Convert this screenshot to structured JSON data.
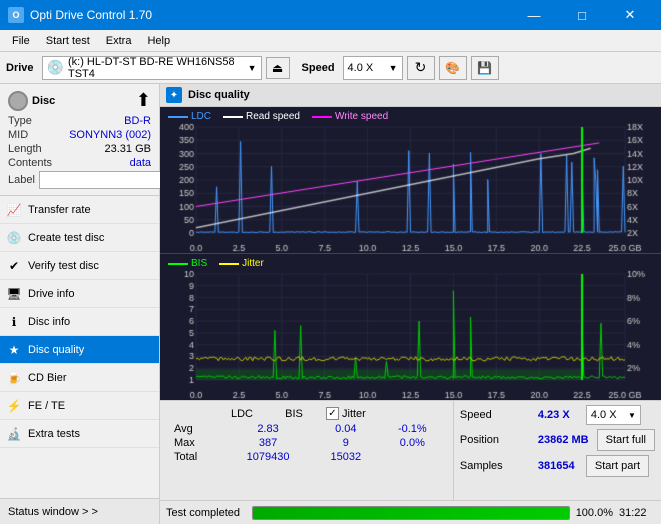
{
  "titleBar": {
    "title": "Opti Drive Control 1.70",
    "minBtn": "—",
    "maxBtn": "□",
    "closeBtn": "✕"
  },
  "menuBar": {
    "items": [
      "File",
      "Start test",
      "Extra",
      "Help"
    ]
  },
  "toolbar": {
    "driveLabel": "Drive",
    "driveValue": "(k:)  HL-DT-ST BD-RE  WH16NS58 TST4",
    "speedLabel": "Speed",
    "speedValue": "4.0 X"
  },
  "discInfo": {
    "type": {
      "label": "Type",
      "value": "BD-R"
    },
    "mid": {
      "label": "MID",
      "value": "SONYNN3 (002)"
    },
    "length": {
      "label": "Length",
      "value": "23.31 GB"
    },
    "contents": {
      "label": "Contents",
      "value": "data"
    },
    "label": {
      "label": "Label",
      "value": ""
    }
  },
  "navItems": [
    {
      "id": "transfer-rate",
      "label": "Transfer rate",
      "active": false
    },
    {
      "id": "create-test-disc",
      "label": "Create test disc",
      "active": false
    },
    {
      "id": "verify-test-disc",
      "label": "Verify test disc",
      "active": false
    },
    {
      "id": "drive-info",
      "label": "Drive info",
      "active": false
    },
    {
      "id": "disc-info",
      "label": "Disc info",
      "active": false
    },
    {
      "id": "disc-quality",
      "label": "Disc quality",
      "active": true
    },
    {
      "id": "cd-bier",
      "label": "CD Bier",
      "active": false
    },
    {
      "id": "fe-te",
      "label": "FE / TE",
      "active": false
    },
    {
      "id": "extra-tests",
      "label": "Extra tests",
      "active": false
    }
  ],
  "statusWindow": {
    "label": "Status window  > >"
  },
  "discQuality": {
    "title": "Disc quality",
    "chart1": {
      "legend": [
        {
          "label": "LDC",
          "color": "#00aaff"
        },
        {
          "label": "Read speed",
          "color": "#ffffff"
        },
        {
          "label": "Write speed",
          "color": "#ff00ff"
        }
      ],
      "yMax": 400,
      "yLabels": [
        "400",
        "350",
        "300",
        "250",
        "200",
        "150",
        "100",
        "50",
        "0"
      ],
      "yRightLabels": [
        "18X",
        "16X",
        "14X",
        "12X",
        "10X",
        "8X",
        "6X",
        "4X",
        "2X"
      ],
      "xLabels": [
        "0.0",
        "2.5",
        "5.0",
        "7.5",
        "10.0",
        "12.5",
        "15.0",
        "17.5",
        "20.0",
        "22.5",
        "25.0 GB"
      ]
    },
    "chart2": {
      "legend": [
        {
          "label": "BIS",
          "color": "#00ff00"
        },
        {
          "label": "Jitter",
          "color": "#ffff00"
        }
      ],
      "yMax": 10,
      "yLabels": [
        "10",
        "9",
        "8",
        "7",
        "6",
        "5",
        "4",
        "3",
        "2",
        "1"
      ],
      "yRightLabels": [
        "10%",
        "8%",
        "6%",
        "4%",
        "2%"
      ],
      "xLabels": [
        "0.0",
        "2.5",
        "5.0",
        "7.5",
        "10.0",
        "12.5",
        "15.0",
        "17.5",
        "20.0",
        "22.5",
        "25.0 GB"
      ]
    }
  },
  "stats": {
    "headers": [
      "",
      "LDC",
      "BIS",
      "",
      "Jitter",
      "Speed",
      ""
    ],
    "rows": [
      {
        "label": "Avg",
        "ldc": "2.83",
        "bis": "0.04",
        "jitter": "-0.1%"
      },
      {
        "label": "Max",
        "ldc": "387",
        "bis": "9",
        "jitter": "0.0%"
      },
      {
        "label": "Total",
        "ldc": "1079430",
        "bis": "15032",
        "jitter": ""
      }
    ],
    "jitterChecked": true,
    "jitterLabel": "Jitter",
    "speedLabel": "Speed",
    "speedValue": "4.23 X",
    "speedSelect": "4.0 X",
    "positionLabel": "Position",
    "positionValue": "23862 MB",
    "samplesLabel": "Samples",
    "samplesValue": "381654",
    "startFullBtn": "Start full",
    "startPartBtn": "Start part"
  },
  "progressBar": {
    "percent": "100.0%",
    "time": "31:22",
    "fill": 100
  },
  "statusText": "Test completed"
}
